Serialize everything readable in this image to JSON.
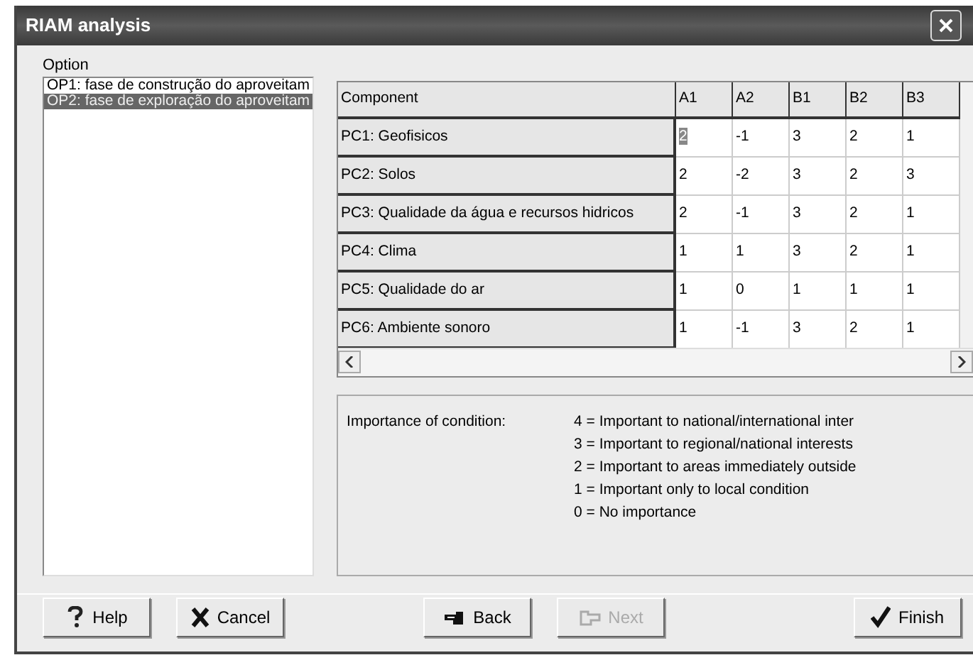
{
  "window": {
    "title": "RIAM analysis"
  },
  "option_label": "Option",
  "options": [
    {
      "label": "OP1: fase de construção do aproveitam",
      "selected": false
    },
    {
      "label": "OP2: fase de exploração do aproveitam",
      "selected": true
    }
  ],
  "grid": {
    "columns": [
      "Component",
      "A1",
      "A2",
      "B1",
      "B2",
      "B3"
    ],
    "rows": [
      {
        "cells": [
          {
            "text": "PC1: Geofisicos",
            "selected": false
          },
          {
            "text": "2",
            "selected": true
          },
          {
            "text": "-1",
            "selected": false
          },
          {
            "text": "3",
            "selected": false
          },
          {
            "text": "2",
            "selected": false
          },
          {
            "text": "1",
            "selected": false
          }
        ]
      },
      {
        "cells": [
          {
            "text": "PC2: Solos",
            "selected": false
          },
          {
            "text": "2",
            "selected": false
          },
          {
            "text": "-2",
            "selected": false
          },
          {
            "text": "3",
            "selected": false
          },
          {
            "text": "2",
            "selected": false
          },
          {
            "text": "3",
            "selected": false
          }
        ]
      },
      {
        "cells": [
          {
            "text": "PC3: Qualidade da água e recursos hidricos",
            "selected": false
          },
          {
            "text": "2",
            "selected": false
          },
          {
            "text": "-1",
            "selected": false
          },
          {
            "text": "3",
            "selected": false
          },
          {
            "text": "2",
            "selected": false
          },
          {
            "text": "1",
            "selected": false
          }
        ]
      },
      {
        "cells": [
          {
            "text": "PC4: Clima",
            "selected": false
          },
          {
            "text": "1",
            "selected": false
          },
          {
            "text": "1",
            "selected": false
          },
          {
            "text": "3",
            "selected": false
          },
          {
            "text": "2",
            "selected": false
          },
          {
            "text": "1",
            "selected": false
          }
        ]
      },
      {
        "cells": [
          {
            "text": "PC5: Qualidade do ar",
            "selected": false
          },
          {
            "text": "1",
            "selected": false
          },
          {
            "text": "0",
            "selected": false
          },
          {
            "text": "1",
            "selected": false
          },
          {
            "text": "1",
            "selected": false
          },
          {
            "text": "1",
            "selected": false
          }
        ]
      },
      {
        "cells": [
          {
            "text": "PC6: Ambiente sonoro",
            "selected": false
          },
          {
            "text": "1",
            "selected": false
          },
          {
            "text": "-1",
            "selected": false
          },
          {
            "text": "3",
            "selected": false
          },
          {
            "text": "2",
            "selected": false
          },
          {
            "text": "1",
            "selected": false
          }
        ]
      }
    ]
  },
  "info": {
    "label": "Importance of condition:",
    "lines": [
      "4 = Important to national/international inter",
      "3 = Important to regional/national interests",
      "2 = Important to areas immediately outside",
      "1 = Important only to local condition",
      "0 = No importance"
    ]
  },
  "buttons": [
    {
      "kind": "help",
      "label": "Help",
      "disabled": false
    },
    {
      "kind": "cancel",
      "label": "Cancel",
      "disabled": false
    },
    {
      "kind": "back",
      "label": "Back",
      "disabled": false
    },
    {
      "kind": "next",
      "label": "Next",
      "disabled": true
    },
    {
      "kind": "finish",
      "label": "Finish",
      "disabled": false
    }
  ]
}
